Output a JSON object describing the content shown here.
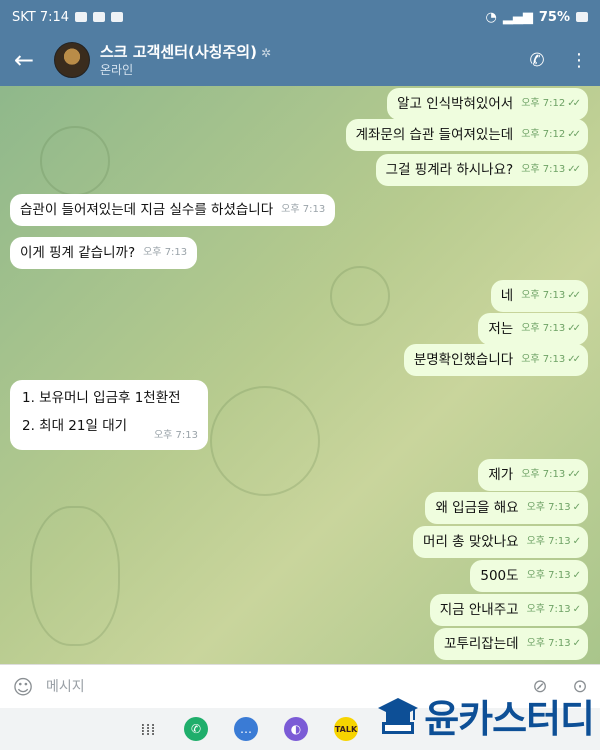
{
  "status_bar": {
    "carrier_time": "SKT 7:14",
    "battery": "75%"
  },
  "header": {
    "title": "스크 고객센터(사칭주의)",
    "title_mark": "✲",
    "status": "온라인"
  },
  "messages": [
    {
      "text": "알고 인식박혀있어서",
      "time": "오후 7:12",
      "dir": "out"
    },
    {
      "text": "계좌문의 습관 들여져있는데",
      "time": "오후 7:12",
      "dir": "out"
    },
    {
      "text": "그걸 핑계라 하시나요?",
      "time": "오후 7:13",
      "dir": "out"
    },
    {
      "text": "습관이 들어져있는데 지금 실수를 하셨습니다",
      "time": "오후 7:13",
      "dir": "in"
    },
    {
      "text": "이게 핑계 같습니까?",
      "time": "오후 7:13",
      "dir": "in"
    },
    {
      "text": "네",
      "time": "오후 7:13",
      "dir": "out"
    },
    {
      "text": "저는",
      "time": "오후 7:13",
      "dir": "out"
    },
    {
      "text": "분명확인했습니다",
      "time": "오후 7:13",
      "dir": "out"
    },
    {
      "lines": [
        "1. 보유머니 입금후  1천환전",
        "2.  최대 21일 대기"
      ],
      "time": "오후 7:13",
      "dir": "in"
    },
    {
      "text": "제가",
      "time": "오후 7:13",
      "dir": "out"
    },
    {
      "text": "왜 입금을 해요",
      "time": "오후 7:13",
      "dir": "out"
    },
    {
      "text": "머리 총 맞았나요",
      "time": "오후 7:13",
      "dir": "out"
    },
    {
      "text": "500도",
      "time": "오후 7:13",
      "dir": "out"
    },
    {
      "text": "지금 안내주고",
      "time": "오후 7:13",
      "dir": "out"
    },
    {
      "text": "꼬투리잡는데",
      "time": "오후 7:13",
      "dir": "out"
    }
  ],
  "input": {
    "placeholder": "메시지"
  },
  "watermark": {
    "text": "윤카스터디"
  },
  "colors": {
    "header": "#517da2",
    "outgoing_bubble": "#effdde",
    "incoming_bubble": "#ffffff",
    "watermark": "#0d4f96"
  }
}
